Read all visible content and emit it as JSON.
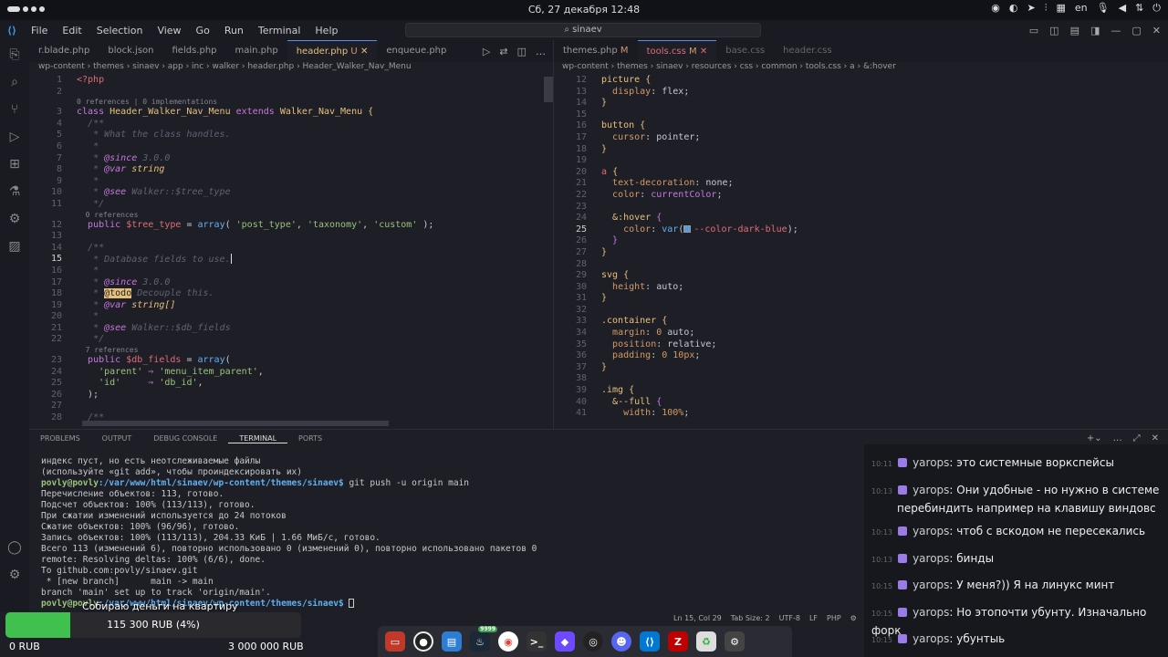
{
  "system_bar": {
    "datetime": "Сб, 27 декабря 12:48",
    "lang": "en"
  },
  "menubar": {
    "items": [
      "File",
      "Edit",
      "Selection",
      "View",
      "Go",
      "Run",
      "Terminal",
      "Help"
    ],
    "search": "sinaev"
  },
  "left_tabs": [
    {
      "label": "r.blade.php",
      "active": false
    },
    {
      "label": "block.json",
      "active": false
    },
    {
      "label": "fields.php",
      "active": false
    },
    {
      "label": "main.php",
      "active": false
    },
    {
      "label": "header.php",
      "mod": "U",
      "active": true
    },
    {
      "label": "enqueue.php",
      "active": false
    }
  ],
  "right_tabs": [
    {
      "label": "themes.php",
      "mod": "M",
      "active": false
    },
    {
      "label": "tools.css",
      "mod": "M",
      "active": true
    },
    {
      "label": "base.css",
      "active": false
    },
    {
      "label": "header.css",
      "active": false
    }
  ],
  "left_breadcrumb": "wp-content › themes › sinaev › app › inc › walker › header.php › Header_Walker_Nav_Menu",
  "right_breadcrumb": "wp-content › themes › sinaev › resources › css › common › tools.css › a › &:hover",
  "panel_tabs": [
    "PROBLEMS",
    "OUTPUT",
    "DEBUG CONSOLE",
    "TERMINAL",
    "PORTS"
  ],
  "terminal": {
    "lines": [
      "индекс пуст, но есть неотслеживаемые файлы",
      "(используйте «git add», чтобы проиндексировать их)",
      "__PROMPT__ git push -u origin main",
      "Перечисление объектов: 113, готово.",
      "Подсчет объектов: 100% (113/113), готово.",
      "При сжатии изменений используется до 24 потоков",
      "Сжатие объектов: 100% (96/96), готово.",
      "Запись объектов: 100% (113/113), 204.33 КиБ | 1.66 МиБ/с, готово.",
      "Всего 113 (изменений 6), повторно использовано 0 (изменений 0), повторно использовано пакетов 0",
      "remote: Resolving deltas: 100% (6/6), done.",
      "To github.com:povly/sinaev.git",
      " * [new branch]      main -> main",
      "branch 'main' set up to track 'origin/main'.",
      "__PROMPT__ "
    ],
    "prompt_user": "povly@povly",
    "prompt_path": ":/var/www/html/sinaev/wp-content/themes/sinaev$"
  },
  "status": {
    "position": "Ln 15, Col 29",
    "tab_size": "Tab Size: 2",
    "encoding": "UTF-8",
    "eol": "LF",
    "language": "PHP"
  },
  "chat": [
    {
      "time": "10:11",
      "user": "yarops",
      "text": "это системные воркспейсы"
    },
    {
      "time": "10:13",
      "user": "yarops",
      "text": "Они удобные - но нужно в системе перебиндить например на клавишу виндовс"
    },
    {
      "time": "10:13",
      "user": "yarops",
      "text": "чтоб с вскодом не пересекались"
    },
    {
      "time": "10:13",
      "user": "yarops",
      "text": "бинды"
    },
    {
      "time": "10:15",
      "user": "yarops",
      "text": "У меня?)) Я на линукс минт"
    },
    {
      "time": "10:15",
      "user": "yarops",
      "text": "Но этопочти убунту. Изначально форк"
    },
    {
      "time": "10:15",
      "user": "yarops",
      "text": "убунтыь"
    }
  ],
  "donation": {
    "title": "Собираю деньги на квартиру",
    "amount": "115 300 RUB (4%)",
    "progress": 0.04,
    "min": "0 RUB",
    "max": "3 000 000 RUB"
  },
  "dock_apps": [
    "files-icon",
    "obs-icon",
    "folder-icon",
    "steam-icon",
    "chrome-icon",
    "terminal-icon",
    "proton-icon",
    "github-icon",
    "discord-icon",
    "vscode-icon",
    "filezilla-icon",
    "trash-icon",
    "settings-icon"
  ],
  "dock_badge": "9999",
  "colors": {
    "accent": "#5a8dee",
    "progress": "#3fc04f"
  }
}
